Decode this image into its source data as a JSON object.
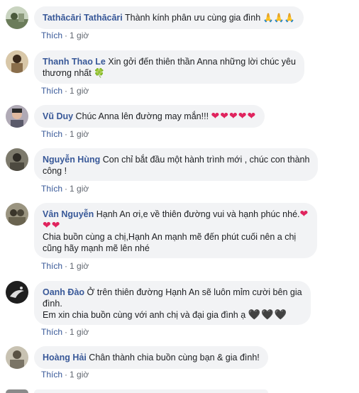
{
  "comments": [
    {
      "name": "Tathācāri Tathācāri",
      "text": "Thành kính phân ưu cùng gia đình",
      "emoji": "🙏🙏🙏",
      "like": "Thích",
      "time": "1 giờ",
      "avatar_color": "#6b7c5a"
    },
    {
      "name": "Thanh Thao Le",
      "text": "Xin gởi đến thiên thần Anna những lời chúc yêu",
      "text2": "thương nhất",
      "emoji": "🍀",
      "like": "Thích",
      "time": "1 giờ",
      "avatar_color": "#8a6e4b"
    },
    {
      "name": "Vũ Duy",
      "text": "Chúc Anna lên đường may mắn!!!",
      "emoji": "❤❤❤❤❤",
      "like": "Thích",
      "time": "1 giờ",
      "avatar_color": "#5a5a6a"
    },
    {
      "name": "Nguyễn Hùng",
      "text": "Con chỉ bắt đầu một hành trình mới , chúc con thành",
      "text2": "công !",
      "like": "Thích",
      "time": "1 giờ",
      "avatar_color": "#4d4a40"
    },
    {
      "name": "Vân Nguyễn",
      "text": "Hạnh An ơi,e về thiên đường vui và hạnh phúc nhé.",
      "emoji": "❤",
      "emoji2": "❤❤",
      "text3": "Chia buồn cùng a chị,Hạnh An mạnh mẽ đến phút cuối nên a chị",
      "text4": "cũng hãy mạnh mẽ lên nhé",
      "like": "Thích",
      "time": "1 giờ",
      "avatar_color": "#6a6450"
    },
    {
      "name": "Oanh Đào",
      "text": "Ở trên thiên đường Hạnh An sẽ luôn mỉm cười bên gia",
      "text2": "đình.",
      "text3": "Em xin chia buồn cùng với anh chị và đại gia đình ạ",
      "emoji": "🖤🖤🖤",
      "like": "Thích",
      "time": "1 giờ",
      "avatar_color": "#1e1e1e"
    },
    {
      "name": "Hoàng Hải",
      "text": "Chân thành chia buồn cùng bạn & gia đình!",
      "like": "Thích",
      "time": "1 giờ",
      "avatar_color": "#7a7466"
    }
  ],
  "colors": {
    "name": "#385898",
    "bubble": "#f2f3f5",
    "meta": "#616770",
    "heart": "#e0245e"
  }
}
